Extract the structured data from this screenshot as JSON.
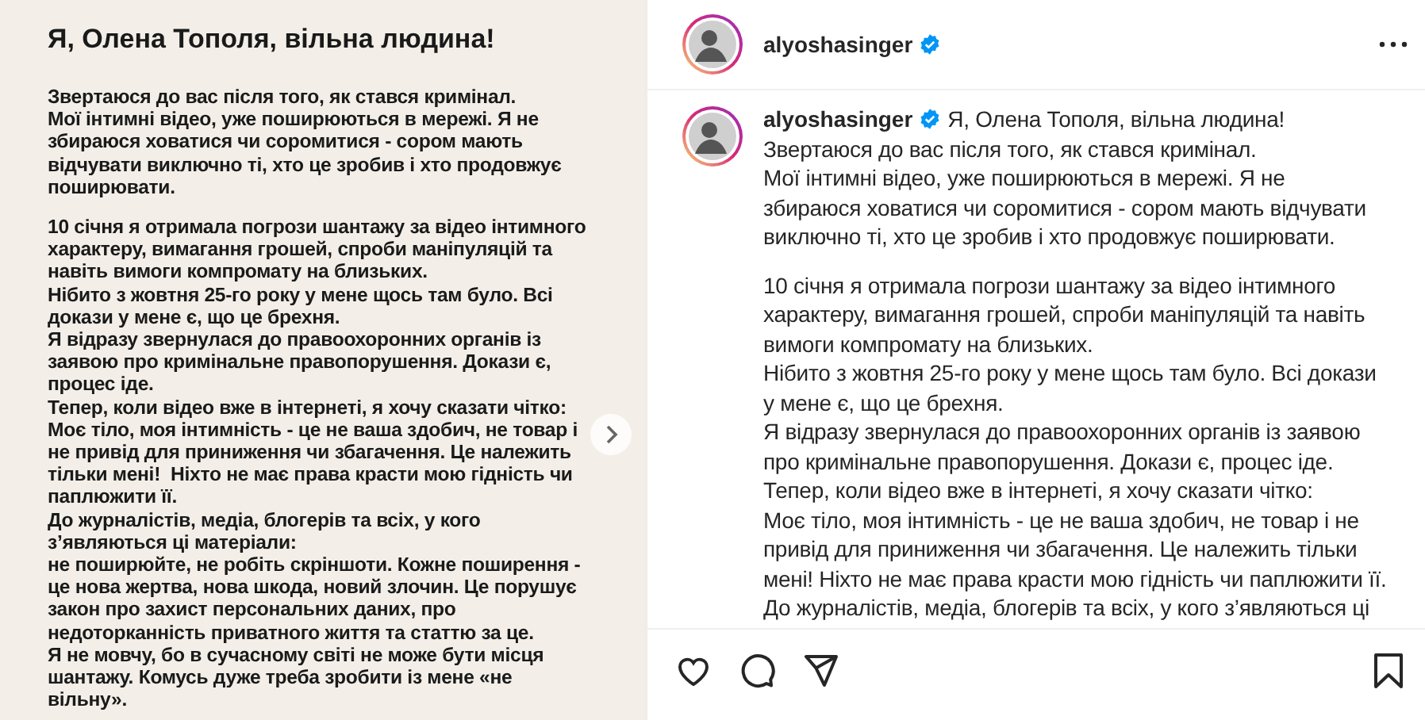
{
  "post_image": {
    "title": "Я, Олена Тополя, вільна людина!",
    "paragraphs": [
      [
        "Звертаюся до вас після того, як стався кримінал.",
        "Мої інтимні відео, уже поширюються в мережі. Я не",
        "збираюся ховатися чи соромитися - сором мають",
        "відчувати виключно ті, хто це зробив і хто продовжує",
        "поширювати."
      ],
      [
        "10 січня я отримала погрози шантажу за відео інтимного",
        "характеру, вимагання грошей, спроби маніпуляцій та",
        "навіть вимоги компромату на близьких.",
        "Нібито з жовтня 25-го року у мене щось там було. Всі",
        "докази у мене є, що це брехня.",
        "Я відразу звернулася до правоохоронних органів із",
        "заявою про кримінальне правопорушення. Докази є,",
        "процес іде.",
        "Тепер, коли відео вже в інтернеті, я хочу сказати чітко:",
        "Моє тіло, моя інтимність - це не ваша здобич, не товар і",
        "не привід для приниження чи збагачення. Це належить",
        "тільки мені!  Ніхто не має права красти мою гідність чи",
        "паплюжити її.",
        "До журналістів, медіа, блогерів та всіх, у кого",
        "з’являються ці матеріали:",
        "не поширюйте, не робіть скріншоти. Кожне поширення -",
        "це нова жертва, нова шкода, новий злочин. Це порушує",
        "закон про захист персональних даних, про",
        "недоторканність приватного життя та статтю за це.",
        "Я не мовчу, бо в сучасному світі не може бути місця",
        "шантажу. Комусь дуже треба зробити із мене «не",
        "вільну»."
      ]
    ]
  },
  "header": {
    "username": "alyoshasinger",
    "verified": true
  },
  "caption": {
    "username": "alyoshasinger",
    "verified": true,
    "paragraphs": [
      [
        "Я, Олена Тополя, вільна людина!",
        "Звертаюся до вас після того, як стався кримінал.",
        "Мої інтимні відео, уже поширюються в мережі. Я не",
        "збираюся ховатися чи соромитися - сором мають відчувати",
        "виключно ті, хто це зробив і хто продовжує поширювати."
      ],
      [
        "10 січня я отримала погрози шантажу за відео інтимного",
        "характеру, вимагання грошей, спроби маніпуляцій та навіть",
        "вимоги компромату на близьких.",
        "Нібито з жовтня 25-го року у мене щось там було. Всі докази",
        "у мене є, що це брехня.",
        "Я відразу звернулася до правоохоронних органів із заявою",
        "про кримінальне правопорушення. Докази є, процес іде.",
        "Тепер, коли відео вже в інтернеті, я хочу сказати чітко:",
        "Моє тіло, моя інтимність - це не ваша здобич, не товар і не",
        "привід для приниження чи збагачення. Це належить тільки",
        "мені! Ніхто не має права красти мою гідність чи паплюжити її.",
        "До журналістів, медіа, блогерів та всіх, у кого з’являються ці"
      ]
    ]
  }
}
